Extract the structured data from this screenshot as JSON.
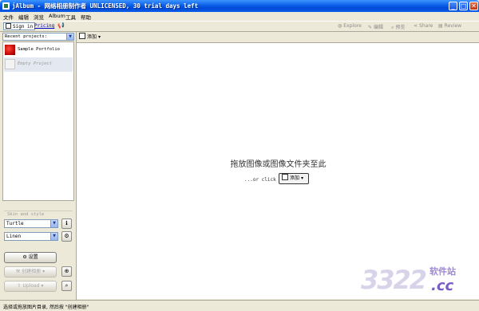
{
  "window": {
    "title": "jAlbum - 网络相册制作者 UNLICENSED, 30 trial days left"
  },
  "menu": [
    "文件",
    "编辑",
    "浏览",
    "Album",
    "工具",
    "帮助"
  ],
  "toolbar": {
    "sign_in": "Sign in",
    "pricing": "Pricing",
    "right_items": [
      {
        "icon": "globe-icon",
        "label": "Explore"
      },
      {
        "icon": "pencil-icon",
        "label": "编辑"
      },
      {
        "icon": "magnifier-icon",
        "label": "预览"
      },
      {
        "icon": "share-icon",
        "label": "Share"
      },
      {
        "icon": "review-icon",
        "label": "Review"
      }
    ]
  },
  "projects": {
    "selector_label": "Recent projects:",
    "items": [
      {
        "label": "Sample Portfolio",
        "thumb": "red"
      },
      {
        "label": "Empty Project",
        "thumb": "empty",
        "selected": true
      }
    ]
  },
  "skin": {
    "section_label": "Skin and style",
    "skin_value": "Turtle",
    "style_value": "Linen",
    "settings_label": "设置",
    "create_label": "创建相册",
    "upload_label": "Upload"
  },
  "main": {
    "add_label": "添加",
    "drop_hint": "拖放图像或图像文件夹至此",
    "or_click": "...or click",
    "add_button_label": "添加"
  },
  "status": {
    "text": "选择或拖放图片目录, 然后按 \"创建相册\""
  },
  "watermark": {
    "number": "3322",
    "site": "软件站",
    "tld": ".cc"
  }
}
